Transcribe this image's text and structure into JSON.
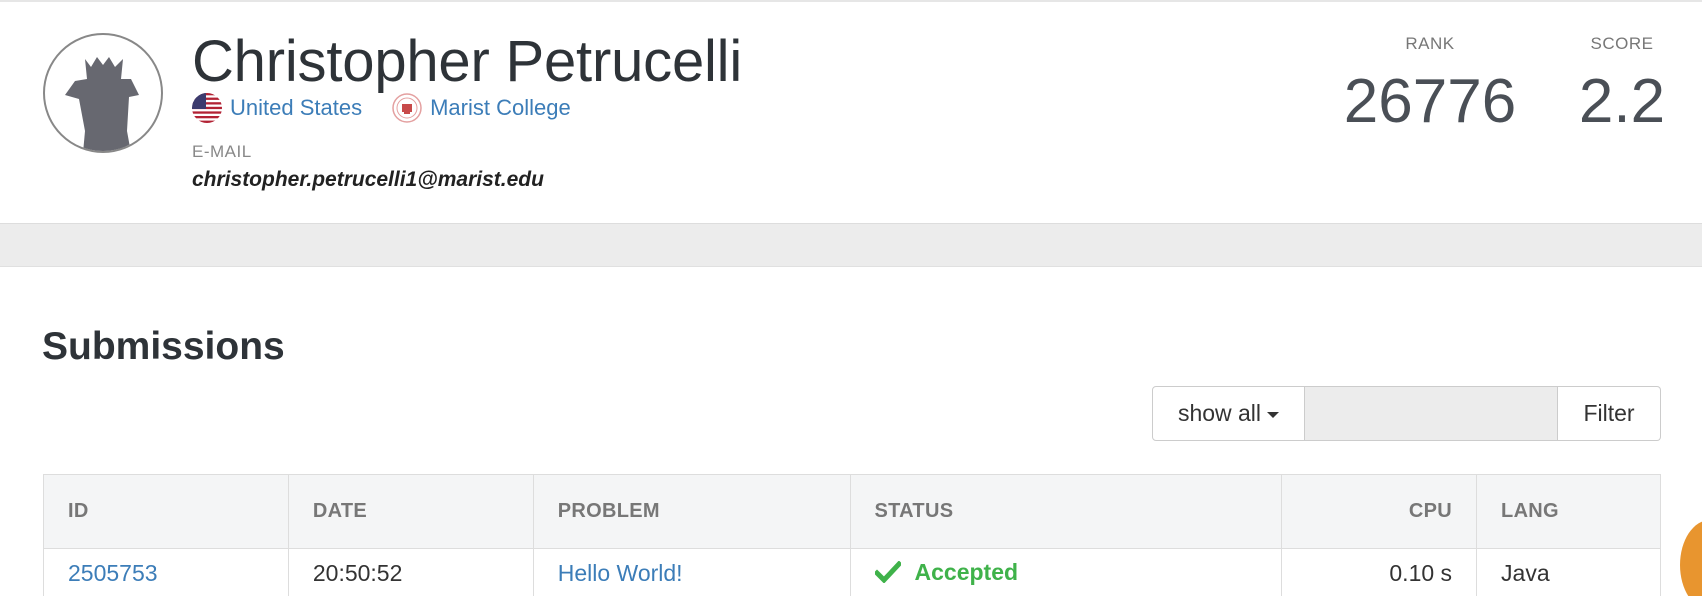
{
  "profile": {
    "name": "Christopher Petrucelli",
    "country": "United States",
    "school": "Marist College",
    "email_label": "E-MAIL",
    "email": "christopher.petrucelli1@marist.edu",
    "rank_label": "RANK",
    "rank": "26776",
    "score_label": "SCORE",
    "score": "2.2"
  },
  "submissions": {
    "title": "Submissions",
    "filter_select": "show all",
    "filter_input_value": "",
    "filter_button": "Filter",
    "columns": [
      "ID",
      "DATE",
      "PROBLEM",
      "STATUS",
      "CPU",
      "LANG"
    ],
    "rows": [
      {
        "id": "2505753",
        "date": "20:50:52",
        "problem": "Hello World!",
        "status": "Accepted",
        "cpu": "0.10 s",
        "lang": "Java"
      }
    ]
  },
  "icons": {
    "country_flag": "us-flag-icon",
    "school_seal": "marist-seal-icon",
    "status_icon": "check-icon",
    "dropdown": "caret-down-icon"
  },
  "colors": {
    "link": "#3c7db8",
    "accepted": "#3fb24a",
    "heading": "#2e3338"
  }
}
